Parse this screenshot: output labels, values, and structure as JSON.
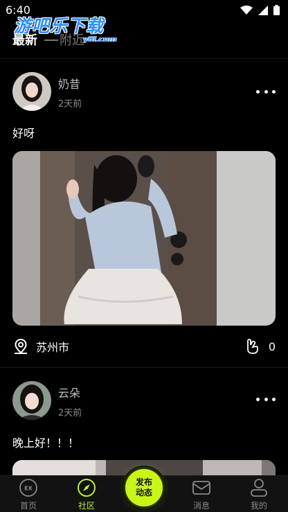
{
  "status_bar": {
    "time": "6:40"
  },
  "watermark": {
    "text": "游吧乐下载",
    "sub": "y8l.com"
  },
  "tabs": [
    {
      "label": "最新",
      "active": true
    },
    {
      "label": "附近",
      "active": false
    }
  ],
  "posts": [
    {
      "username": "奶昔",
      "time": "2天前",
      "text": "好呀",
      "location": "苏州市",
      "likes": "0"
    },
    {
      "username": "云朵",
      "time": "2天前",
      "text": "晚上好！！！"
    }
  ],
  "bottom_nav": {
    "items": [
      {
        "label": "首页",
        "icon": "home-icon",
        "active": false
      },
      {
        "label": "社区",
        "icon": "compass-icon",
        "active": true
      },
      {
        "label": "消息",
        "icon": "message-icon",
        "active": false
      },
      {
        "label": "我的",
        "icon": "profile-icon",
        "active": false
      }
    ],
    "publish_line1": "发布",
    "publish_line2": "动态"
  },
  "colors": {
    "accent": "#c8f51a",
    "active_nav": "#b9f230",
    "background": "#000000"
  }
}
